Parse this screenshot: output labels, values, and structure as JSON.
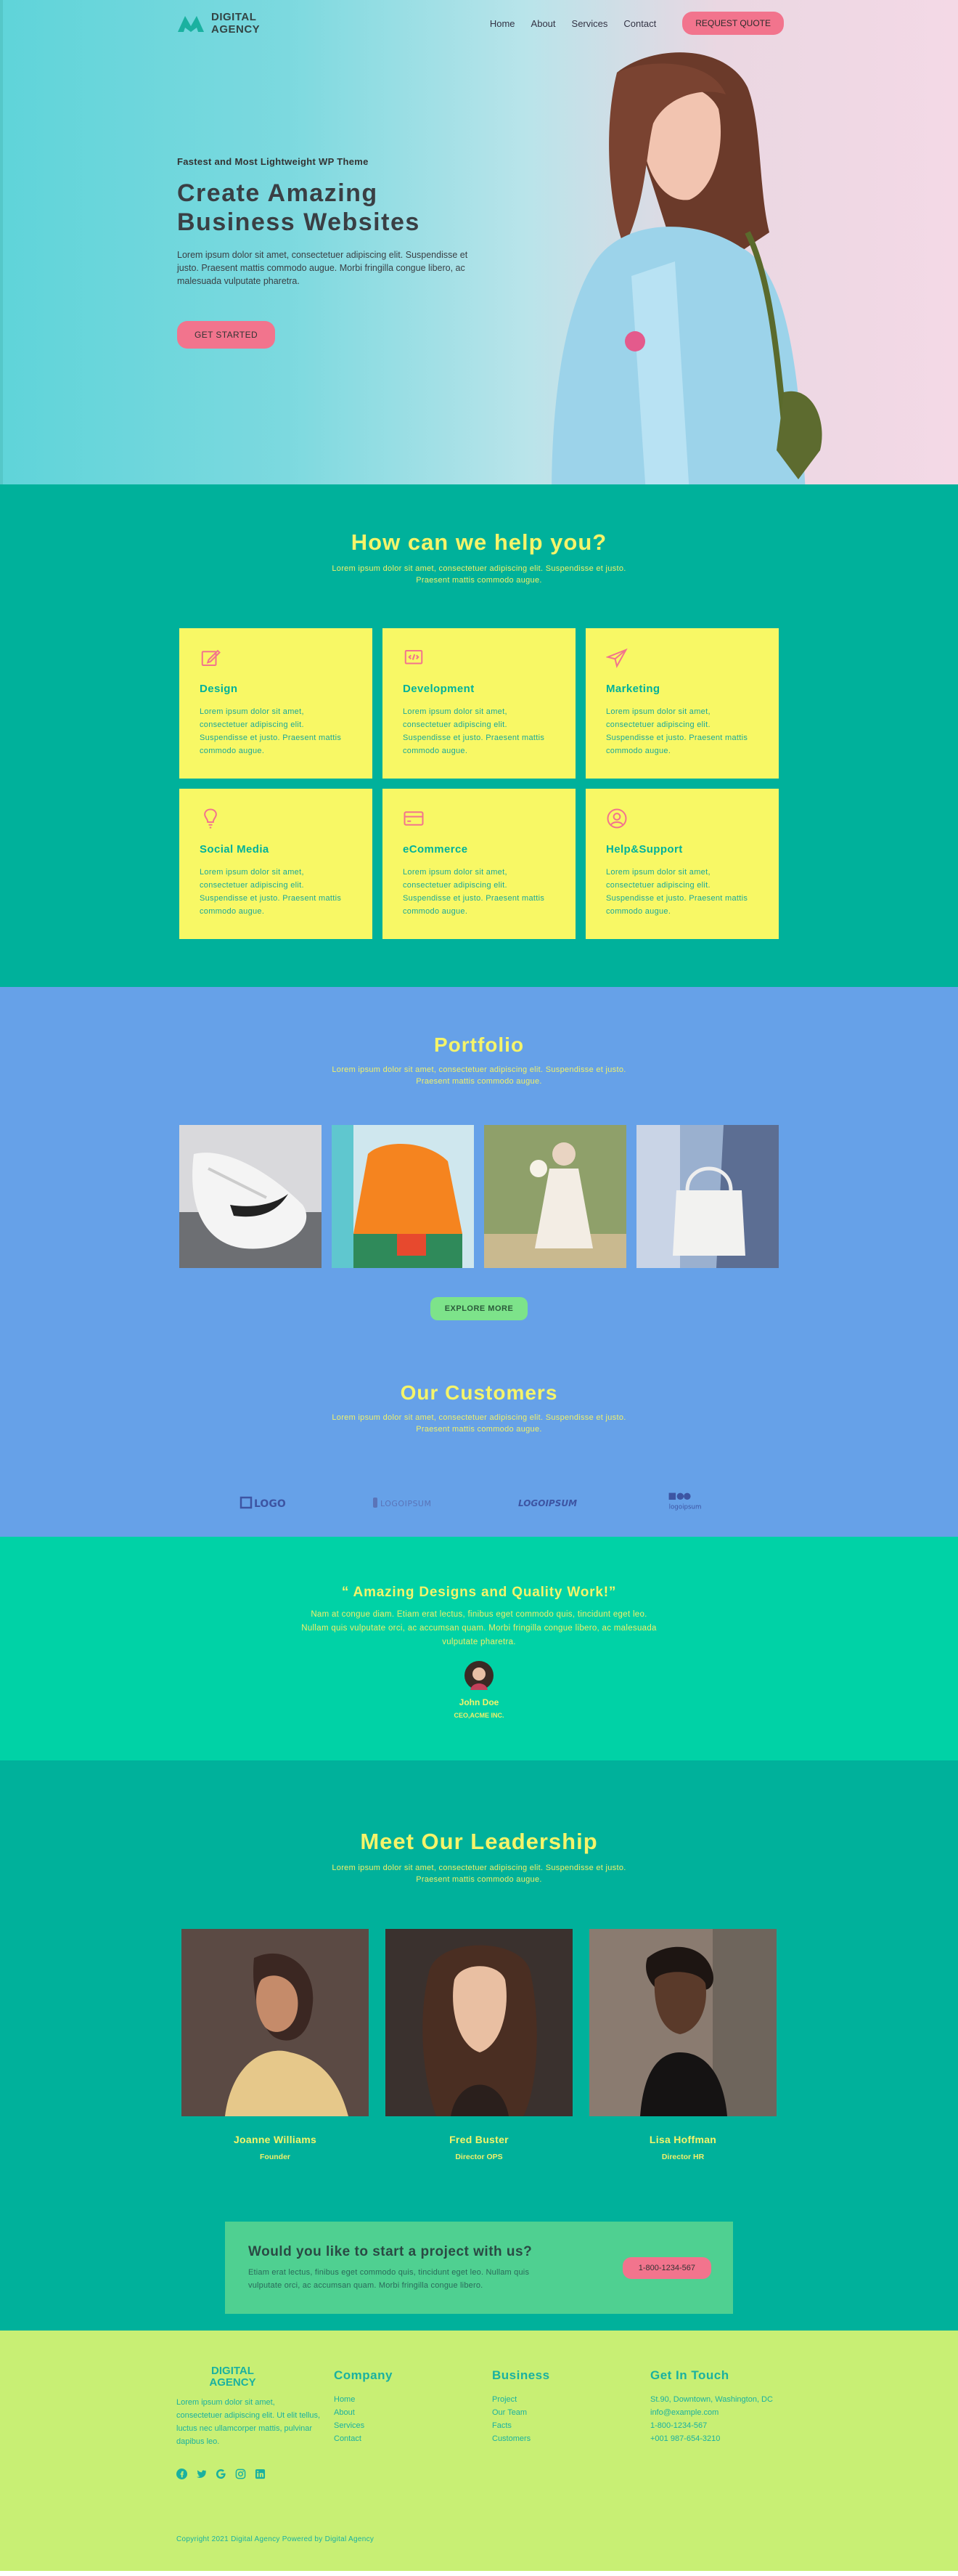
{
  "brand": {
    "name": "DIGITAL\nAGENCY"
  },
  "nav": {
    "items": [
      "Home",
      "About",
      "Services",
      "Contact"
    ],
    "quote_button": "REQUEST QUOTE"
  },
  "hero": {
    "eyebrow": "Fastest and Most Lightweight WP Theme",
    "title": "Create  Amazing\nBusiness Websites",
    "text": "Lorem ipsum dolor sit amet, consectetuer adipiscing elit. Suspendisse et justo. Praesent mattis commodo augue. Morbi fringilla congue libero, ac malesuada vulputate pharetra.",
    "button": "GET STARTED"
  },
  "services": {
    "title": "How can we help you?",
    "subtitle": "Lorem ipsum dolor sit amet, consectetuer adipiscing elit. Suspendisse et justo. Praesent mattis commodo augue.",
    "items": [
      {
        "icon": "edit-icon",
        "name": "Design",
        "desc": "Lorem ipsum dolor sit amet, consectetuer adipiscing elit. Suspendisse et justo. Praesent mattis commodo augue."
      },
      {
        "icon": "dev-icon",
        "name": "Development",
        "desc": "Lorem ipsum dolor sit amet, consectetuer adipiscing elit. Suspendisse et justo. Praesent mattis commodo augue."
      },
      {
        "icon": "send-icon",
        "name": "Marketing",
        "desc": "Lorem ipsum dolor sit amet, consectetuer adipiscing elit. Suspendisse et justo. Praesent mattis commodo augue."
      },
      {
        "icon": "lightbulb-icon",
        "name": "Social Media",
        "desc": "Lorem ipsum dolor sit amet, consectetuer adipiscing elit. Suspendisse et justo. Praesent mattis commodo augue."
      },
      {
        "icon": "credit-card-icon",
        "name": "eCommerce",
        "desc": "Lorem ipsum dolor sit amet, consectetuer adipiscing elit. Suspendisse et justo. Praesent mattis commodo augue."
      },
      {
        "icon": "user-circle-icon",
        "name": "Help&Support",
        "desc": "Lorem ipsum dolor sit amet, consectetuer adipiscing elit. Suspendisse et justo. Praesent mattis commodo augue."
      }
    ]
  },
  "portfolio": {
    "title": "Portfolio",
    "subtitle": "Lorem ipsum dolor sit amet, consectetuer adipiscing elit. Suspendisse et justo. Praesent mattis commodo augue.",
    "button": "EXPLORE MORE"
  },
  "customers": {
    "title": "Our Customers",
    "subtitle": "Lorem ipsum dolor sit amet, consectetuer adipiscing elit. Suspendisse et justo. Praesent mattis commodo augue.",
    "logos": [
      "LOGO",
      "LOGOIPSUM",
      "LOGOIPSUM",
      "logoipsum"
    ]
  },
  "testimonial": {
    "quote": "“ Amazing Designs and Quality Work!”",
    "text": "Nam at congue diam. Etiam erat lectus, finibus eget commodo quis, tincidunt eget leo. Nullam quis vulputate orci, ac accumsan quam. Morbi fringilla congue libero, ac malesuada vulputate pharetra.",
    "name": "John Doe",
    "role": "CEO,ACME INC."
  },
  "leadership": {
    "title": "Meet Our Leadership",
    "subtitle": "Lorem ipsum dolor sit amet, consectetuer adipiscing elit. Suspendisse et justo. Praesent mattis commodo augue.",
    "members": [
      {
        "name": "Joanne Williams",
        "role": "Founder"
      },
      {
        "name": "Fred Buster",
        "role": "Director OPS"
      },
      {
        "name": "Lisa Hoffman",
        "role": "Director HR"
      }
    ]
  },
  "cta": {
    "title": "Would you like to start a project with us?",
    "text": "Etiam erat lectus, finibus eget commodo quis, tincidunt eget leo. Nullam quis vulputate orci, ac accumsan quam. Morbi fringilla congue libero.",
    "button": "1-800-1234-567"
  },
  "footer": {
    "about": "Lorem ipsum dolor sit amet, consectetuer adipiscing elit. Ut elit tellus, luctus nec ullamcorper mattis, pulvinar dapibus leo.",
    "company": {
      "title": "Company",
      "links": [
        "Home",
        "About",
        "Services",
        "Contact"
      ]
    },
    "business": {
      "title": "Business",
      "links": [
        "Project",
        "Our Team",
        "Facts",
        "Customers"
      ]
    },
    "contact": {
      "title": "Get In Touch",
      "lines": [
        "St.90, Downtown, Washington, DC",
        "info@example.com",
        "1-800-1234-567",
        "+001 987-654-3210"
      ]
    },
    "socials": [
      "facebook-icon",
      "twitter-icon",
      "google-icon",
      "instagram-icon",
      "linkedin-icon"
    ],
    "copyright": "Copyright 2021 Digital Agency   Powered by Digital Agency"
  },
  "colors": {
    "teal": "#00b19b",
    "yellow": "#f5f46a",
    "pink": "#f2748d",
    "blue": "#66a1e8",
    "mint": "#00d2a6",
    "lime": "#c8ef74"
  }
}
